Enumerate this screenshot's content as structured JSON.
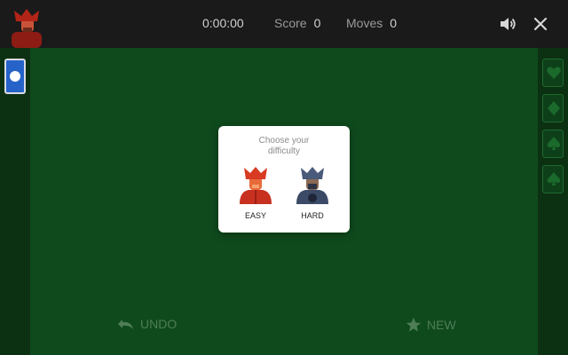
{
  "header": {
    "timer": "0:00:00",
    "score_label": "Score",
    "score_value": "0",
    "moves_label": "Moves",
    "moves_value": "0"
  },
  "modal": {
    "title": "Choose your difficulty",
    "options": [
      {
        "label": "EASY",
        "icon": "red-king-icon"
      },
      {
        "label": "HARD",
        "icon": "blue-king-icon"
      }
    ]
  },
  "footer": {
    "undo_label": "UNDO",
    "new_label": "NEW"
  },
  "foundations": [
    "heart-icon",
    "diamond-icon",
    "spade-icon",
    "club-icon"
  ],
  "colors": {
    "felt": "#0f4a1d",
    "rail": "#0c3012",
    "topbar": "#1a1a1a",
    "easy": "#c8301f",
    "hard": "#3b4a66"
  }
}
